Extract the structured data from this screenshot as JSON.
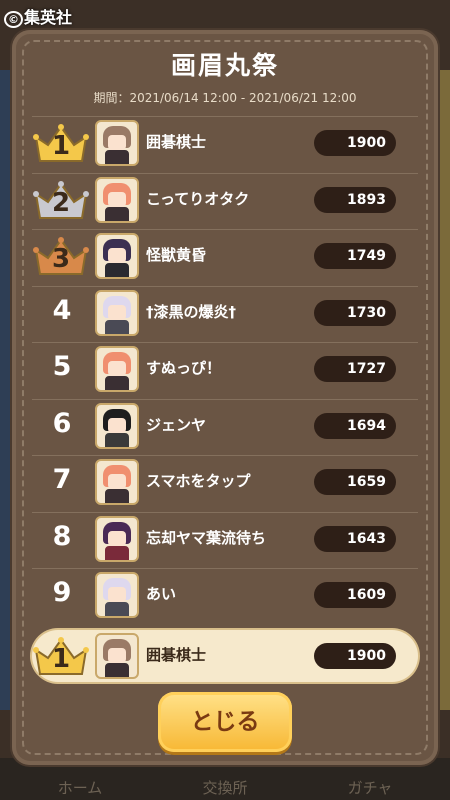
{
  "copyright": "集英社",
  "bg_nav": [
    "ホーム",
    "交換所",
    "ガチャ"
  ],
  "title": "画眉丸祭",
  "period": "期間：2021/06/14 12:00 - 2021/06/21 12:00",
  "rows": [
    {
      "rank": "1",
      "name": "囲碁棋士",
      "score": "1900",
      "crown": "gold",
      "hair": "#9a7a66",
      "body": "#3a2f33"
    },
    {
      "rank": "2",
      "name": "こってりオタク",
      "score": "1893",
      "crown": "silver",
      "hair": "#f08f6f",
      "body": "#3a2f33"
    },
    {
      "rank": "3",
      "name": "怪獣黄昏",
      "score": "1749",
      "crown": "bronze",
      "hair": "#3b2f52",
      "body": "#2a2a30"
    },
    {
      "rank": "4",
      "name": "†漆黒の爆炎†",
      "score": "1730",
      "crown": "",
      "hair": "#ded8ee",
      "body": "#4a4a55"
    },
    {
      "rank": "5",
      "name": "すぬっぴ！",
      "score": "1727",
      "crown": "",
      "hair": "#f08f6f",
      "body": "#3a2f33"
    },
    {
      "rank": "6",
      "name": "ジェンヤ",
      "score": "1694",
      "crown": "",
      "hair": "#1e1e1e",
      "body": "#3a3a3a"
    },
    {
      "rank": "7",
      "name": "スマホをタップ",
      "score": "1659",
      "crown": "",
      "hair": "#f08f6f",
      "body": "#3a2f33"
    },
    {
      "rank": "8",
      "name": "忘却ヤマ葉流待ち",
      "score": "1643",
      "crown": "",
      "hair": "#4a2a55",
      "body": "#7a2a3a"
    },
    {
      "rank": "9",
      "name": "あい",
      "score": "1609",
      "crown": "",
      "hair": "#ded8ee",
      "body": "#4a4a55"
    }
  ],
  "me": {
    "rank": "1",
    "name": "囲碁棋士",
    "score": "1900",
    "crown": "gold",
    "hair": "#9a7a66",
    "body": "#3a2f33"
  },
  "close_label": "とじる",
  "crown_colors": {
    "gold": "#f4c84a",
    "silver": "#c9c9cf",
    "bronze": "#d8894a"
  }
}
